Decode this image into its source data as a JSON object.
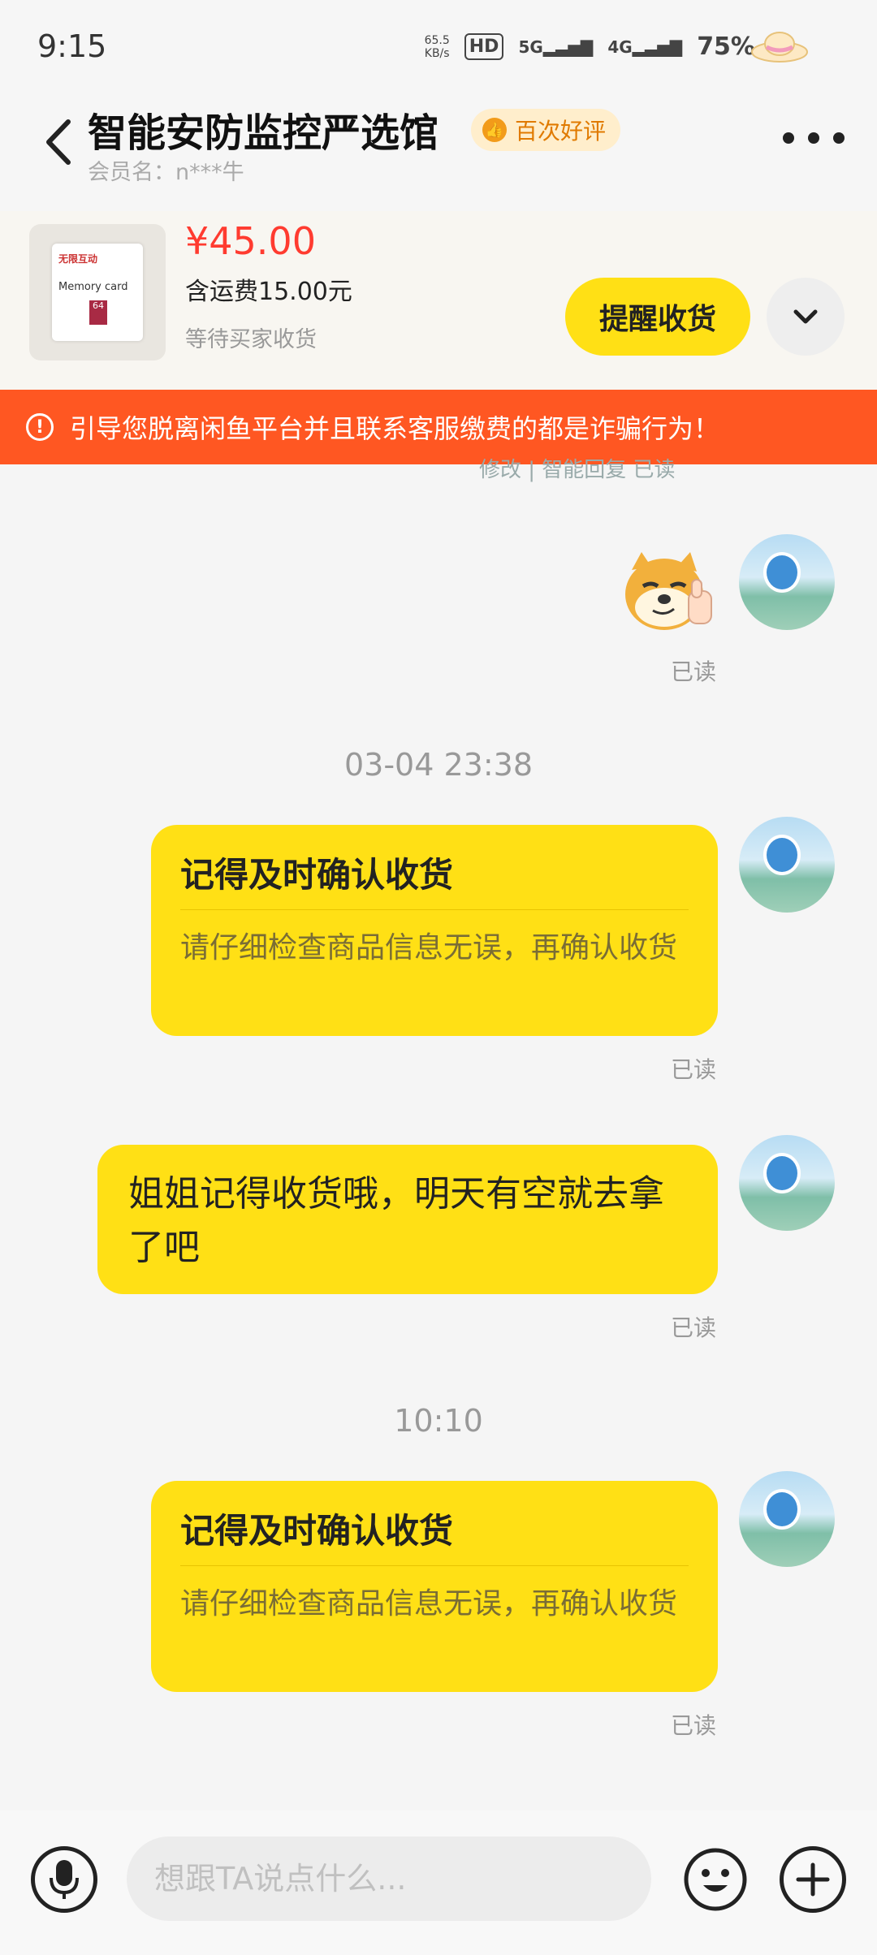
{
  "status_bar": {
    "time": "9:15",
    "net_speed": "65.5",
    "net_unit": "KB/s",
    "hd": "HD",
    "sim1": "5G",
    "sim2": "4G",
    "battery": "75%"
  },
  "header": {
    "shop_name": "智能安防监控严选馆",
    "badge": "百次好评",
    "member": "会员名：n***牛"
  },
  "product": {
    "price": "¥45.00",
    "shipping": "含运费15.00元",
    "status": "等待买家收货",
    "remind_button": "提醒收货",
    "image_brand": "无限互动",
    "image_text": "Memory card",
    "image_chip": "64"
  },
  "warning": {
    "icon": "!",
    "text": "引导您脱离闲鱼平台并且联系客服缴费的都是诈骗行为！"
  },
  "peek_text": "修改 | 智能回复   已读",
  "messages": {
    "read": "已读",
    "ts1": "03-04 23:38",
    "card1_title": "记得及时确认收货",
    "card1_desc": "请仔细检查商品信息无误，再确认收货",
    "text1": "姐姐记得收货哦，明天有空就去拿了吧",
    "ts2": "10:10",
    "card2_title": "记得及时确认收货",
    "card2_desc": "请仔细检查商品信息无误，再确认收货"
  },
  "input": {
    "placeholder": "想跟TA说点什么..."
  },
  "colors": {
    "accent_yellow": "#ffe015",
    "warning_orange": "#ff5722",
    "price_red": "#ff3b30"
  }
}
